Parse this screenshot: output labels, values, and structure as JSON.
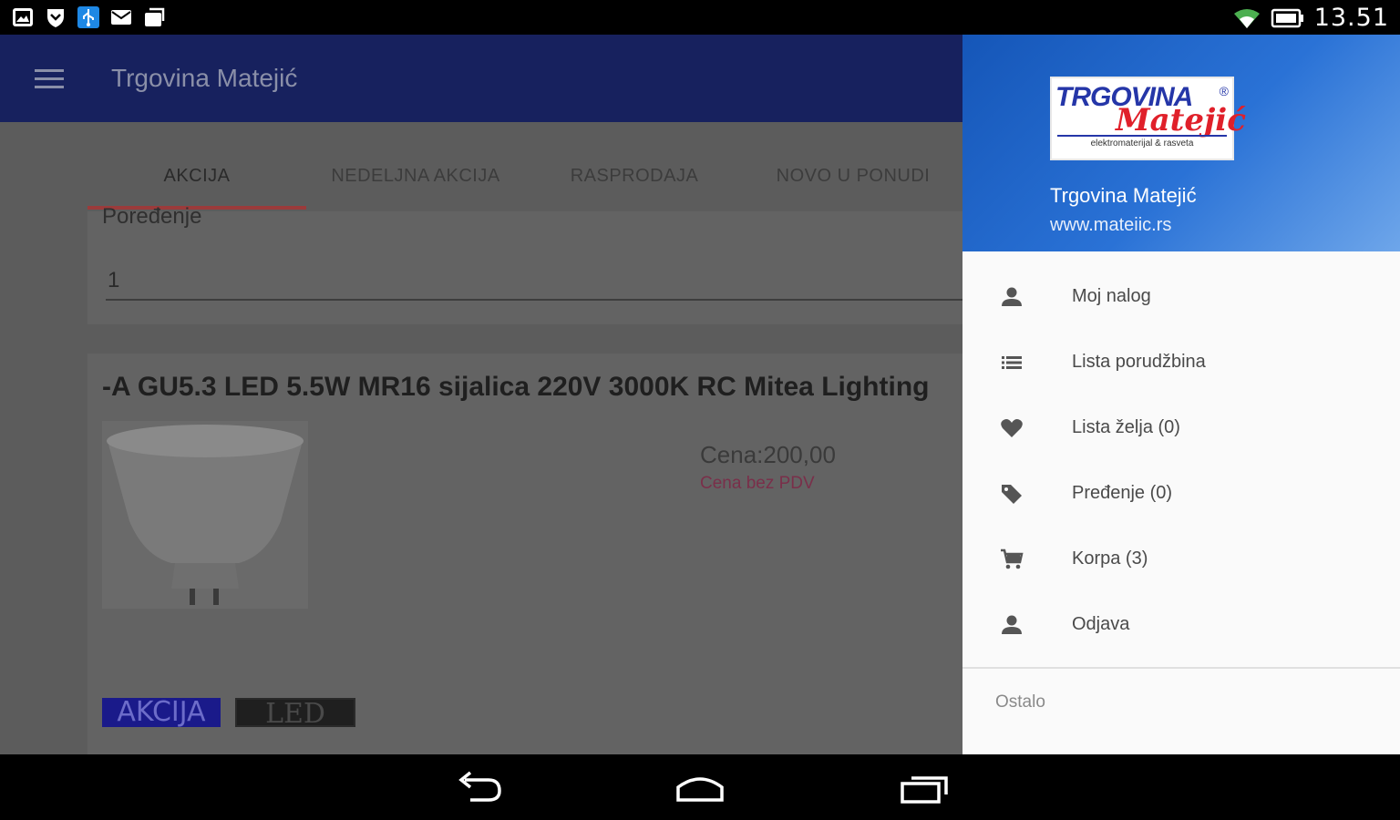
{
  "status_bar": {
    "clock": "13.51",
    "left_icons": [
      "gallery-icon",
      "shield-icon",
      "usb-icon",
      "mail-icon",
      "sync-icon"
    ],
    "right_icons": [
      "wifi-icon",
      "battery-icon"
    ]
  },
  "app_bar": {
    "title": "Trgovina Matejić",
    "menu_icon": "hamburger-icon",
    "color": "#17215e"
  },
  "tabs": [
    {
      "label": "AKCIJA",
      "active": true
    },
    {
      "label": "NEDELJNA AKCIJA",
      "active": false
    },
    {
      "label": "RASPRODAJA",
      "active": false
    },
    {
      "label": "NOVO U PONUDI",
      "active": false
    }
  ],
  "compare_card": {
    "label": "Poređenje",
    "quantity": "1"
  },
  "product": {
    "title": "-A GU5.3 LED 5.5W MR16 sijalica 220V 3000K RC Mitea Lighting",
    "image": "led-bulb-image",
    "price": "Cena:200,00",
    "price_note": "Cena bez PDV",
    "tags": [
      "AKCIJA",
      "LED"
    ]
  },
  "drawer": {
    "store_name": "Trgovina Matejić",
    "url": "www.mateiic.rs",
    "logo": {
      "top_text": "TRGOVINA",
      "reg": "®",
      "script_text": "Matejić",
      "sub_text": "elektromaterijal & rasveta"
    },
    "menu": [
      {
        "icon": "person-icon",
        "label": "Moj nalog"
      },
      {
        "icon": "list-icon",
        "label": "Lista porudžbina"
      },
      {
        "icon": "heart-icon",
        "label": "Lista želja (0)"
      },
      {
        "icon": "tag-icon",
        "label": "Pređenje (0)"
      },
      {
        "icon": "cart-icon",
        "label": "Korpa (3)"
      },
      {
        "icon": "person-icon",
        "label": "Odjava"
      }
    ],
    "section_label": "Ostalo"
  },
  "nav_bar": {
    "buttons": [
      "back-icon",
      "home-icon",
      "recents-icon"
    ]
  }
}
